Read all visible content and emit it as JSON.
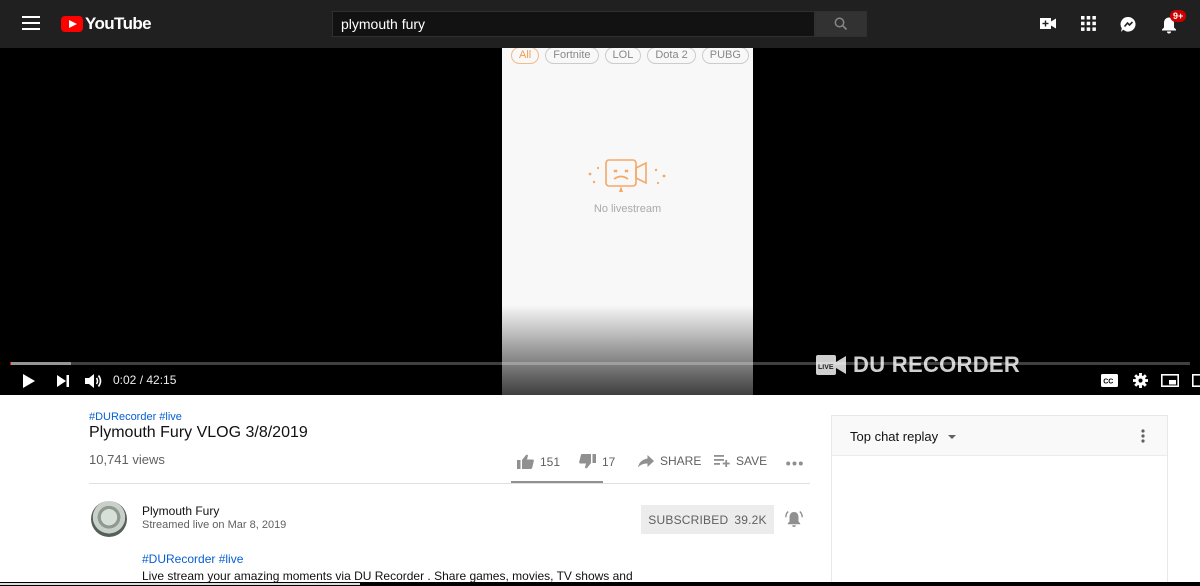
{
  "header": {
    "logo_text": "YouTube",
    "search_value": "plymouth fury",
    "notification_count": "9+"
  },
  "player": {
    "chips": [
      "All",
      "Fortnite",
      "LOL",
      "Dota 2",
      "PUBG"
    ],
    "no_livestream_text": "No livestream",
    "watermark": "DU RECORDER",
    "time_display": "0:02 / 42:15",
    "played_fraction": 0.0008,
    "buffered_fraction": 0.052
  },
  "video": {
    "hashtags": "#DURecorder #live",
    "title": "Plymouth Fury VLOG 3/8/2019",
    "views": "10,741 views",
    "likes": "151",
    "dislikes": "17",
    "share_label": "SHARE",
    "save_label": "SAVE"
  },
  "channel": {
    "name": "Plymouth Fury",
    "streamed": "Streamed live on Mar 8, 2019",
    "subscribe_label": "SUBSCRIBED",
    "subscriber_count": "39.2K",
    "desc_tags": "#DURecorder #live",
    "description": "Live stream your amazing moments via DU Recorder . Share games, movies, TV shows and"
  },
  "chat": {
    "title": "Top chat replay"
  },
  "colors": {
    "brand_red": "#ff0000",
    "link_blue": "#065fd4",
    "accent_orange": "#f39c4a"
  }
}
